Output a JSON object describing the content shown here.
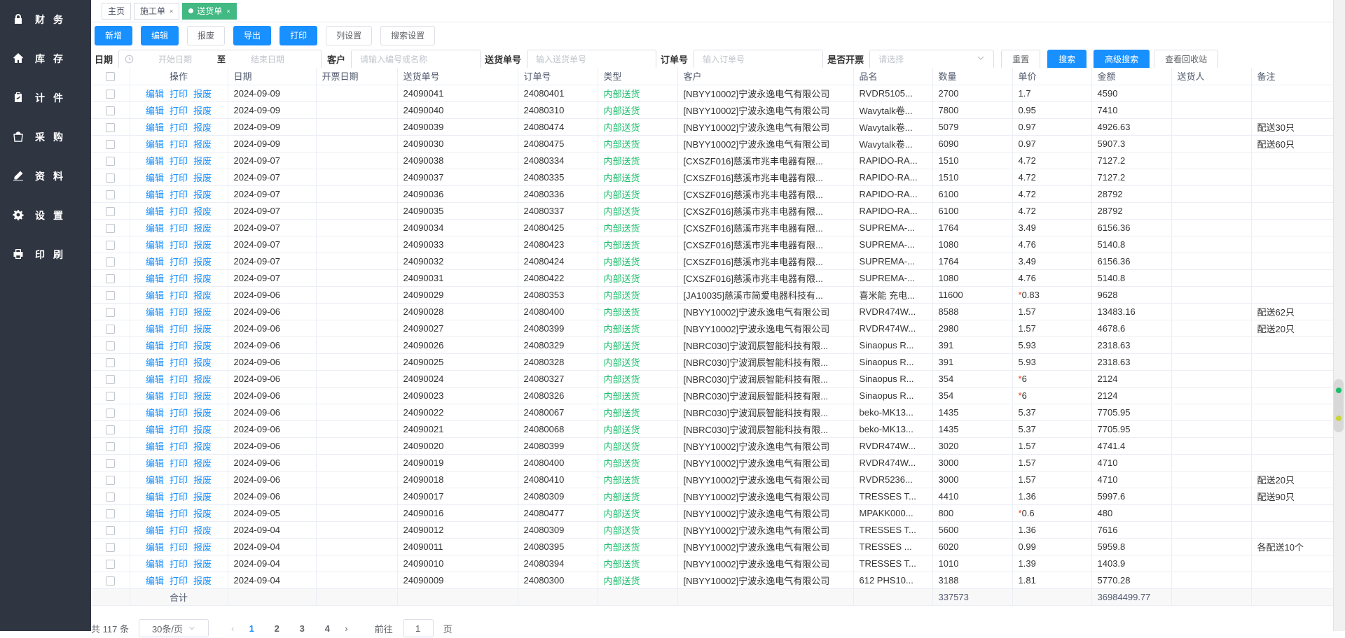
{
  "sidebar": {
    "items": [
      {
        "label": "财务",
        "icon": "lock-icon"
      },
      {
        "label": "库存",
        "icon": "home-icon"
      },
      {
        "label": "计件",
        "icon": "clipboard-check-icon"
      },
      {
        "label": "采购",
        "icon": "shopping-bag-icon"
      },
      {
        "label": "资料",
        "icon": "edit-icon"
      },
      {
        "label": "设置",
        "icon": "gear-icon"
      },
      {
        "label": "印刷",
        "icon": "printer-icon"
      }
    ]
  },
  "tabs": [
    {
      "label": "主页",
      "closable": false,
      "active": false
    },
    {
      "label": "施工单",
      "closable": true,
      "active": false
    },
    {
      "label": "送货单",
      "closable": true,
      "active": true
    }
  ],
  "toolbar": {
    "add": "新增",
    "edit": "编辑",
    "scrap": "报废",
    "export": "导出",
    "print": "打印",
    "columns": "列设置",
    "search_settings": "搜索设置"
  },
  "filters": {
    "date_label": "日期",
    "start_placeholder": "开始日期",
    "to": "至",
    "end_placeholder": "结束日期",
    "customer_label": "客户",
    "customer_placeholder": "请输入编号或名称",
    "delivery_no_label": "送货单号",
    "delivery_no_placeholder": "输入送货单号",
    "order_no_label": "订单号",
    "order_no_placeholder": "输入订单号",
    "invoice_label": "是否开票",
    "invoice_placeholder": "请选择",
    "reset": "重置",
    "search": "搜索",
    "advanced": "高级搜索",
    "recycle": "查看回收站"
  },
  "table": {
    "headers": [
      "操作",
      "日期",
      "开票日期",
      "送货单号",
      "订单号",
      "类型",
      "客户",
      "品名",
      "数量",
      "单价",
      "金额",
      "送货人",
      "备注"
    ],
    "ops": [
      "编辑",
      "打印",
      "报废"
    ],
    "rows": [
      [
        "2024-09-09",
        "",
        "24090041",
        "24080401",
        "内部送货",
        "[NBYY10002]宁波永逸电气有限公司",
        "RVDR5105...",
        "2700",
        "1.7",
        "4590",
        "",
        ""
      ],
      [
        "2024-09-09",
        "",
        "24090040",
        "24080310",
        "内部送货",
        "[NBYY10002]宁波永逸电气有限公司",
        "Wavytalk卷...",
        "7800",
        "0.95",
        "7410",
        "",
        ""
      ],
      [
        "2024-09-09",
        "",
        "24090039",
        "24080474",
        "内部送货",
        "[NBYY10002]宁波永逸电气有限公司",
        "Wavytalk卷...",
        "5079",
        "0.97",
        "4926.63",
        "",
        "配送30只"
      ],
      [
        "2024-09-09",
        "",
        "24090030",
        "24080475",
        "内部送货",
        "[NBYY10002]宁波永逸电气有限公司",
        "Wavytalk卷...",
        "6090",
        "0.97",
        "5907.3",
        "",
        "配送60只"
      ],
      [
        "2024-09-07",
        "",
        "24090038",
        "24080334",
        "内部送货",
        "[CXSZF016]慈溪市兆丰电器有限...",
        "RAPIDO-RA...",
        "1510",
        "4.72",
        "7127.2",
        "",
        ""
      ],
      [
        "2024-09-07",
        "",
        "24090037",
        "24080335",
        "内部送货",
        "[CXSZF016]慈溪市兆丰电器有限...",
        "RAPIDO-RA...",
        "1510",
        "4.72",
        "7127.2",
        "",
        ""
      ],
      [
        "2024-09-07",
        "",
        "24090036",
        "24080336",
        "内部送货",
        "[CXSZF016]慈溪市兆丰电器有限...",
        "RAPIDO-RA...",
        "6100",
        "4.72",
        "28792",
        "",
        ""
      ],
      [
        "2024-09-07",
        "",
        "24090035",
        "24080337",
        "内部送货",
        "[CXSZF016]慈溪市兆丰电器有限...",
        "RAPIDO-RA...",
        "6100",
        "4.72",
        "28792",
        "",
        ""
      ],
      [
        "2024-09-07",
        "",
        "24090034",
        "24080425",
        "内部送货",
        "[CXSZF016]慈溪市兆丰电器有限...",
        "SUPREMA-...",
        "1764",
        "3.49",
        "6156.36",
        "",
        ""
      ],
      [
        "2024-09-07",
        "",
        "24090033",
        "24080423",
        "内部送货",
        "[CXSZF016]慈溪市兆丰电器有限...",
        "SUPREMA-...",
        "1080",
        "4.76",
        "5140.8",
        "",
        ""
      ],
      [
        "2024-09-07",
        "",
        "24090032",
        "24080424",
        "内部送货",
        "[CXSZF016]慈溪市兆丰电器有限...",
        "SUPREMA-...",
        "1764",
        "3.49",
        "6156.36",
        "",
        ""
      ],
      [
        "2024-09-07",
        "",
        "24090031",
        "24080422",
        "内部送货",
        "[CXSZF016]慈溪市兆丰电器有限...",
        "SUPREMA-...",
        "1080",
        "4.76",
        "5140.8",
        "",
        ""
      ],
      [
        "2024-09-06",
        "",
        "24090029",
        "24080353",
        "内部送货",
        "[JA10035]慈溪市简爱电器科技有...",
        "喜米能  充电...",
        "11600",
        "*0.83",
        "9628",
        "",
        ""
      ],
      [
        "2024-09-06",
        "",
        "24090028",
        "24080400",
        "内部送货",
        "[NBYY10002]宁波永逸电气有限公司",
        "RVDR474W...",
        "8588",
        "1.57",
        "13483.16",
        "",
        "配送62只"
      ],
      [
        "2024-09-06",
        "",
        "24090027",
        "24080399",
        "内部送货",
        "[NBYY10002]宁波永逸电气有限公司",
        "RVDR474W...",
        "2980",
        "1.57",
        "4678.6",
        "",
        "配送20只"
      ],
      [
        "2024-09-06",
        "",
        "24090026",
        "24080329",
        "内部送货",
        "[NBRC030]宁波润辰智能科技有限...",
        "Sinaopus R...",
        "391",
        "5.93",
        "2318.63",
        "",
        ""
      ],
      [
        "2024-09-06",
        "",
        "24090025",
        "24080328",
        "内部送货",
        "[NBRC030]宁波润辰智能科技有限...",
        "Sinaopus R...",
        "391",
        "5.93",
        "2318.63",
        "",
        ""
      ],
      [
        "2024-09-06",
        "",
        "24090024",
        "24080327",
        "内部送货",
        "[NBRC030]宁波润辰智能科技有限...",
        "Sinaopus R...",
        "354",
        "*6",
        "2124",
        "",
        ""
      ],
      [
        "2024-09-06",
        "",
        "24090023",
        "24080326",
        "内部送货",
        "[NBRC030]宁波润辰智能科技有限...",
        "Sinaopus R...",
        "354",
        "*6",
        "2124",
        "",
        ""
      ],
      [
        "2024-09-06",
        "",
        "24090022",
        "24080067",
        "内部送货",
        "[NBRC030]宁波润辰智能科技有限...",
        "beko-MK13...",
        "1435",
        "5.37",
        "7705.95",
        "",
        ""
      ],
      [
        "2024-09-06",
        "",
        "24090021",
        "24080068",
        "内部送货",
        "[NBRC030]宁波润辰智能科技有限...",
        "beko-MK13...",
        "1435",
        "5.37",
        "7705.95",
        "",
        ""
      ],
      [
        "2024-09-06",
        "",
        "24090020",
        "24080399",
        "内部送货",
        "[NBYY10002]宁波永逸电气有限公司",
        "RVDR474W...",
        "3020",
        "1.57",
        "4741.4",
        "",
        ""
      ],
      [
        "2024-09-06",
        "",
        "24090019",
        "24080400",
        "内部送货",
        "[NBYY10002]宁波永逸电气有限公司",
        "RVDR474W...",
        "3000",
        "1.57",
        "4710",
        "",
        ""
      ],
      [
        "2024-09-06",
        "",
        "24090018",
        "24080410",
        "内部送货",
        "[NBYY10002]宁波永逸电气有限公司",
        "RVDR5236...",
        "3000",
        "1.57",
        "4710",
        "",
        "配送20只"
      ],
      [
        "2024-09-06",
        "",
        "24090017",
        "24080309",
        "内部送货",
        "[NBYY10002]宁波永逸电气有限公司",
        "TRESSES T...",
        "4410",
        "1.36",
        "5997.6",
        "",
        "配送90只"
      ],
      [
        "2024-09-05",
        "",
        "24090016",
        "24080477",
        "内部送货",
        "[NBYY10002]宁波永逸电气有限公司",
        "MPAKK000...",
        "800",
        "*0.6",
        "480",
        "",
        ""
      ],
      [
        "2024-09-04",
        "",
        "24090012",
        "24080309",
        "内部送货",
        "[NBYY10002]宁波永逸电气有限公司",
        "TRESSES T...",
        "5600",
        "1.36",
        "7616",
        "",
        ""
      ],
      [
        "2024-09-04",
        "",
        "24090011",
        "24080395",
        "内部送货",
        "[NBYY10002]宁波永逸电气有限公司",
        "TRESSES  ...",
        "6020",
        "0.99",
        "5959.8",
        "",
        "各配送10个"
      ],
      [
        "2024-09-04",
        "",
        "24090010",
        "24080394",
        "内部送货",
        "[NBYY10002]宁波永逸电气有限公司",
        "TRESSES T...",
        "1010",
        "1.39",
        "1403.9",
        "",
        ""
      ],
      [
        "2024-09-04",
        "",
        "24090009",
        "24080300",
        "内部送货",
        "[NBYY10002]宁波永逸电气有限公司",
        "612 PHS10...",
        "3188",
        "1.81",
        "5770.28",
        "",
        ""
      ]
    ],
    "summary": {
      "label": "合计",
      "quantity": "337573",
      "amount": "36984499.77"
    }
  },
  "pagination": {
    "total": "共 117 条",
    "page_size": "30条/页",
    "pages": [
      "1",
      "2",
      "3",
      "4"
    ],
    "current": "1",
    "goto_label": "前往",
    "goto_value": "1",
    "goto_suffix": "页"
  },
  "colors": {
    "sidebar_bg": "#2f3541",
    "primary": "#1890ff",
    "active_tab": "#42b983",
    "type_green": "#19be6b",
    "star_red": "#ed4014"
  }
}
